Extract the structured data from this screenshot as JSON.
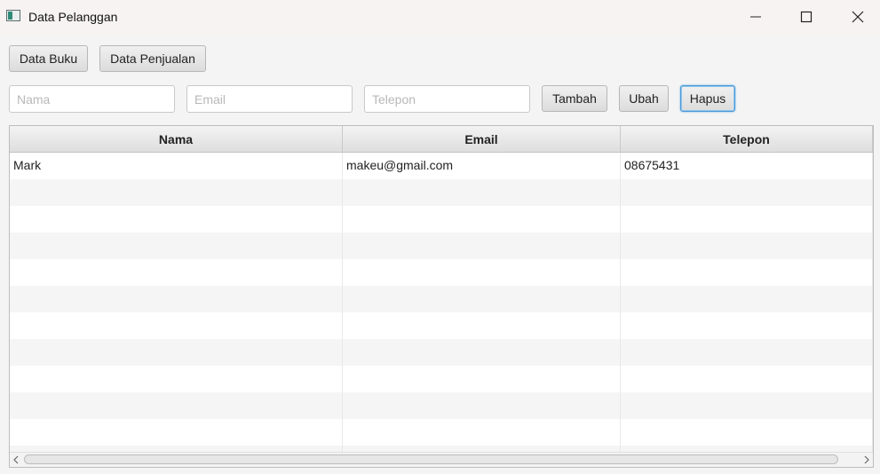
{
  "window": {
    "title": "Data Pelanggan",
    "controls": [
      "minimize-icon",
      "maximize-icon",
      "close-icon"
    ]
  },
  "nav": {
    "data_buku_label": "Data Buku",
    "data_penjualan_label": "Data Penjualan"
  },
  "form": {
    "nama_placeholder": "Nama",
    "email_placeholder": "Email",
    "telepon_placeholder": "Telepon",
    "nama_value": "",
    "email_value": "",
    "telepon_value": "",
    "tambah_label": "Tambah",
    "ubah_label": "Ubah",
    "hapus_label": "Hapus"
  },
  "table": {
    "columns": [
      "Nama",
      "Email",
      "Telepon"
    ],
    "rows": [
      [
        "Mark",
        "makeu@gmail.com",
        "08675431"
      ]
    ]
  },
  "colors": {
    "focus_border": "#4a9ad8",
    "accent_icon": "#2f8a78"
  }
}
